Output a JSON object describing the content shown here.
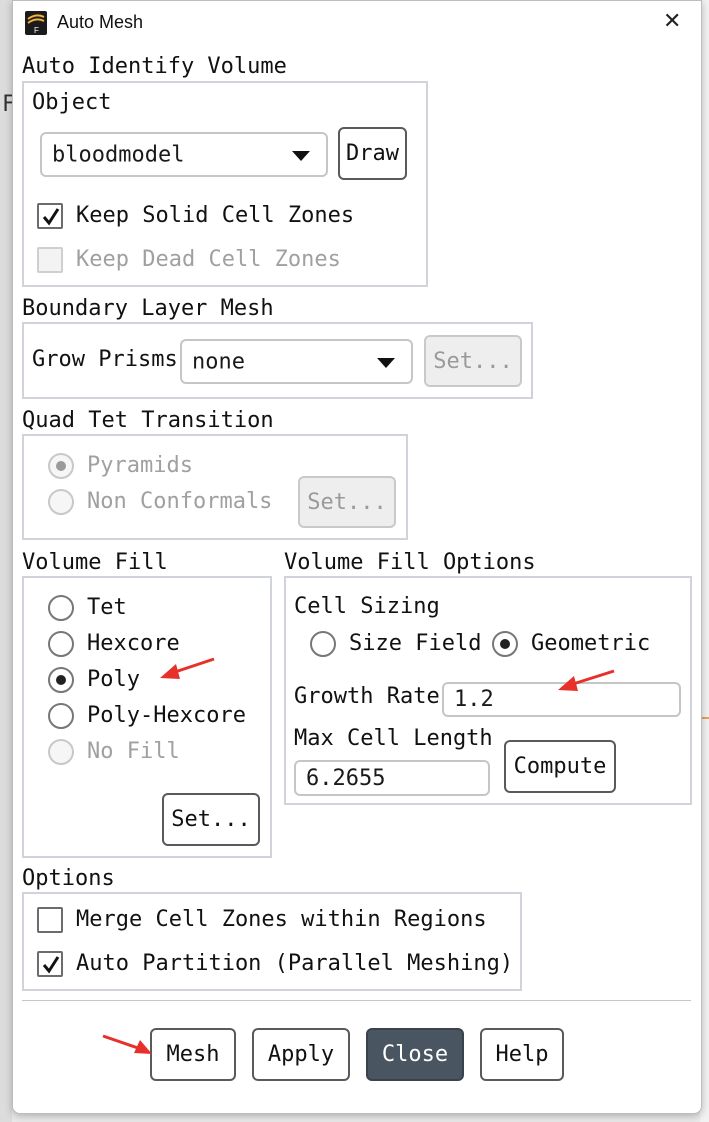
{
  "window": {
    "title": "Auto Mesh",
    "close_glyph": "✕",
    "app_icon": "fluent-app-icon"
  },
  "background": {
    "left_letter": "F"
  },
  "auto_identify": {
    "section": "Auto Identify Volume",
    "group": "Object",
    "object_value": "bloodmodel",
    "draw_label": "Draw",
    "keep_solid": {
      "label": "Keep Solid Cell Zones",
      "checked": true
    },
    "keep_dead": {
      "label": "Keep Dead Cell Zones",
      "checked": false,
      "disabled": true
    }
  },
  "boundary_layer": {
    "section": "Boundary Layer Mesh",
    "grow_label": "Grow Prisms",
    "grow_value": "none",
    "set_label": "Set..."
  },
  "quad_tet": {
    "section": "Quad Tet Transition",
    "options": [
      "Pyramids",
      "Non Conformals"
    ],
    "selected": "Pyramids",
    "set_label": "Set..."
  },
  "volume_fill": {
    "section": "Volume Fill",
    "options": [
      "Tet",
      "Hexcore",
      "Poly",
      "Poly-Hexcore",
      "No Fill"
    ],
    "selected": "Poly",
    "set_label": "Set..."
  },
  "volume_fill_options": {
    "section": "Volume Fill Options",
    "cell_sizing": "Cell Sizing",
    "size_field": "Size Field",
    "geometric": "Geometric",
    "selected": "Geometric",
    "growth_rate_label": "Growth Rate",
    "growth_rate_value": "1.2",
    "max_cell_label": "Max Cell Length",
    "max_cell_value": "6.2655",
    "compute_label": "Compute"
  },
  "options": {
    "section": "Options",
    "merge": {
      "label": "Merge Cell Zones within Regions",
      "checked": false
    },
    "auto_partition": {
      "label": "Auto Partition (Parallel Meshing)",
      "checked": true
    }
  },
  "buttons": {
    "mesh": "Mesh",
    "apply": "Apply",
    "close": "Close",
    "help": "Help"
  },
  "colors": {
    "primary_button": "#4a5562",
    "annotation_arrow": "#e8302a"
  }
}
